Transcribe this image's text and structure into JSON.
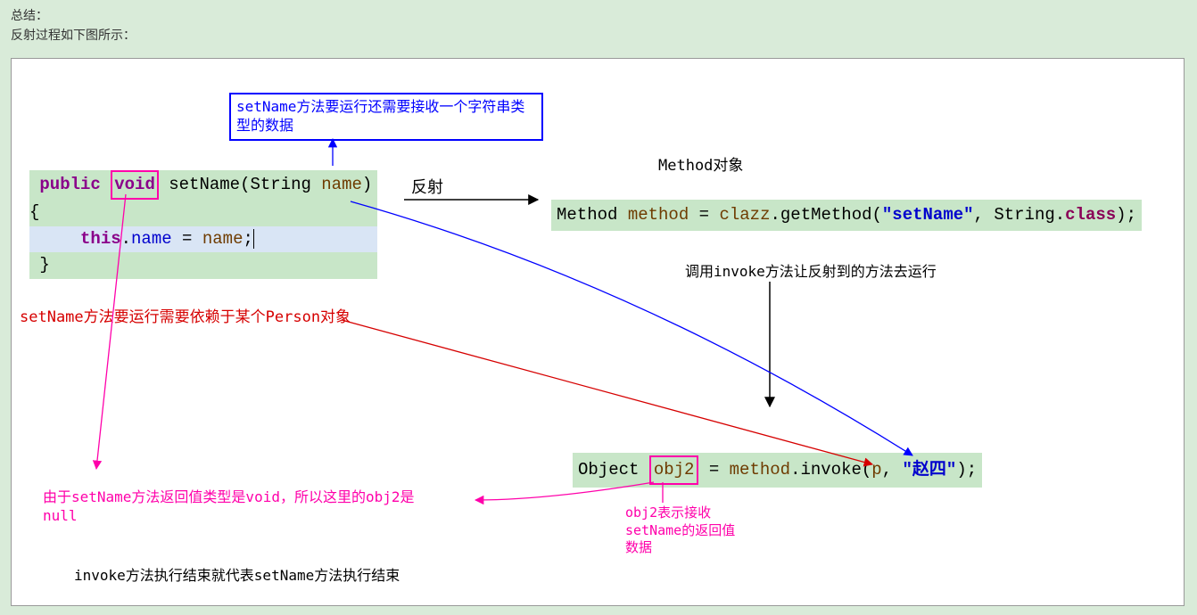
{
  "header": {
    "line1": "总结：",
    "line2": "反射过程如下图所示："
  },
  "blueBox": "setName方法要运行还需要接收一个字符串类型的数据",
  "codeLeft": {
    "sig_public": "public",
    "sig_void": "void",
    "sig_name": "setName(String ",
    "sig_param": "name",
    "sig_close": ") {",
    "body_this": "this",
    "body_dot": ".",
    "body_name": "name",
    "body_eq": " = ",
    "body_name2": "name",
    "body_semi": ";",
    "close": "}"
  },
  "labels": {
    "reflect": "反射",
    "methodObj": "Method对象",
    "invokeCall": "调用invoke方法让反射到的方法去运行",
    "redNote": "setName方法要运行需要依赖于某个Person对象",
    "magentaNote": "由于setName方法返回值类型是void，所以这里的obj2是null",
    "invokeEnd": "invoke方法执行结束就代表setName方法执行结束",
    "obj2Note": "obj2表示接收setName的返回值数据"
  },
  "codeRight": {
    "t1": "Method ",
    "t2": "method",
    "t3": " = ",
    "t4": "clazz",
    "t5": ".getMethod(",
    "t6": "\"setName\"",
    "t7": ", String.",
    "t8": "class",
    "t9": ");"
  },
  "codeBottom": {
    "t1": "Object ",
    "t2": "obj2",
    "t3": " = ",
    "t4": "method",
    "t5": ".invoke(",
    "t6": "p",
    "t7": ", ",
    "t8": "\"赵四\"",
    "t9": ");"
  }
}
